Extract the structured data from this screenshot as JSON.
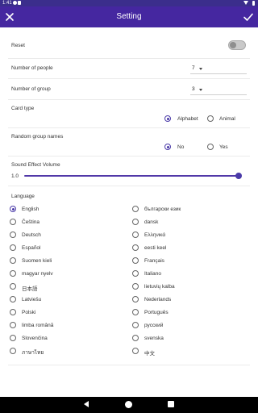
{
  "status_bar": {
    "time": "1:41"
  },
  "app_bar": {
    "title": "Setting"
  },
  "reset": {
    "label": "Reset",
    "enabled": false
  },
  "people": {
    "label": "Number of people",
    "value": "7"
  },
  "group": {
    "label": "Number of group",
    "value": "3"
  },
  "card_type": {
    "label": "Card type",
    "options": [
      "Alphabet",
      "Animal"
    ],
    "selected": "Alphabet"
  },
  "random_names": {
    "label": "Random group names",
    "options": [
      "No",
      "Yes"
    ],
    "selected": "No"
  },
  "volume": {
    "label": "Sound Effect Volume",
    "value_text": "1.0",
    "level": 1.0
  },
  "language": {
    "label": "Language",
    "selected": "English",
    "left": [
      "English",
      "Čeština",
      "Deutsch",
      "Español",
      "Suomen kieli",
      "magyar nyelv",
      "日本語",
      "Latviešu",
      "Polski",
      "limba română",
      "Slovenčina",
      "ภาษาไทย"
    ],
    "right": [
      "български език",
      "dansk",
      "Ελληνικά",
      "eesti keel",
      "Français",
      "Italiano",
      "lietuvių kalba",
      "Nederlands",
      "Português",
      "русский",
      "svenska",
      "中文"
    ]
  },
  "colors": {
    "primary": "#4527a0",
    "status_bar": "#3b2e8c",
    "accent": "#4a3aa8"
  }
}
